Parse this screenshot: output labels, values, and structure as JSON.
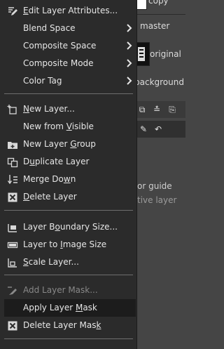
{
  "background": {
    "top_label": "copy",
    "layer_master": "master",
    "layer_original": "original",
    "layer_background": "background",
    "hint_guide": "or guide",
    "hint_layer": "tive layer"
  },
  "menu": {
    "items": [
      {
        "label": "Edit Layer Attributes...",
        "icon": "edit-attributes-icon"
      },
      {
        "label": "Blend Space",
        "submenu": true
      },
      {
        "label": "Composite Space",
        "submenu": true
      },
      {
        "label": "Composite Mode",
        "submenu": true
      },
      {
        "label": "Color Tag",
        "submenu": true
      },
      {
        "label": "New Layer...",
        "icon": "new-layer-icon"
      },
      {
        "label": "New from Visible"
      },
      {
        "label": "New Layer Group",
        "icon": "layer-group-icon"
      },
      {
        "label": "Duplicate Layer",
        "icon": "duplicate-layer-icon"
      },
      {
        "label": "Merge Down",
        "icon": "merge-down-icon"
      },
      {
        "label": "Delete Layer",
        "icon": "delete-icon"
      },
      {
        "label": "Layer Boundary Size...",
        "icon": "boundary-size-icon"
      },
      {
        "label": "Layer to Image Size",
        "icon": "layer-to-image-icon"
      },
      {
        "label": "Scale Layer...",
        "icon": "scale-layer-icon"
      },
      {
        "label": "Add Layer Mask...",
        "icon": "add-mask-icon",
        "disabled": true
      },
      {
        "label": "Apply Layer Mask",
        "active": true
      },
      {
        "label": "Delete Layer Mask",
        "icon": "delete-icon"
      }
    ]
  }
}
